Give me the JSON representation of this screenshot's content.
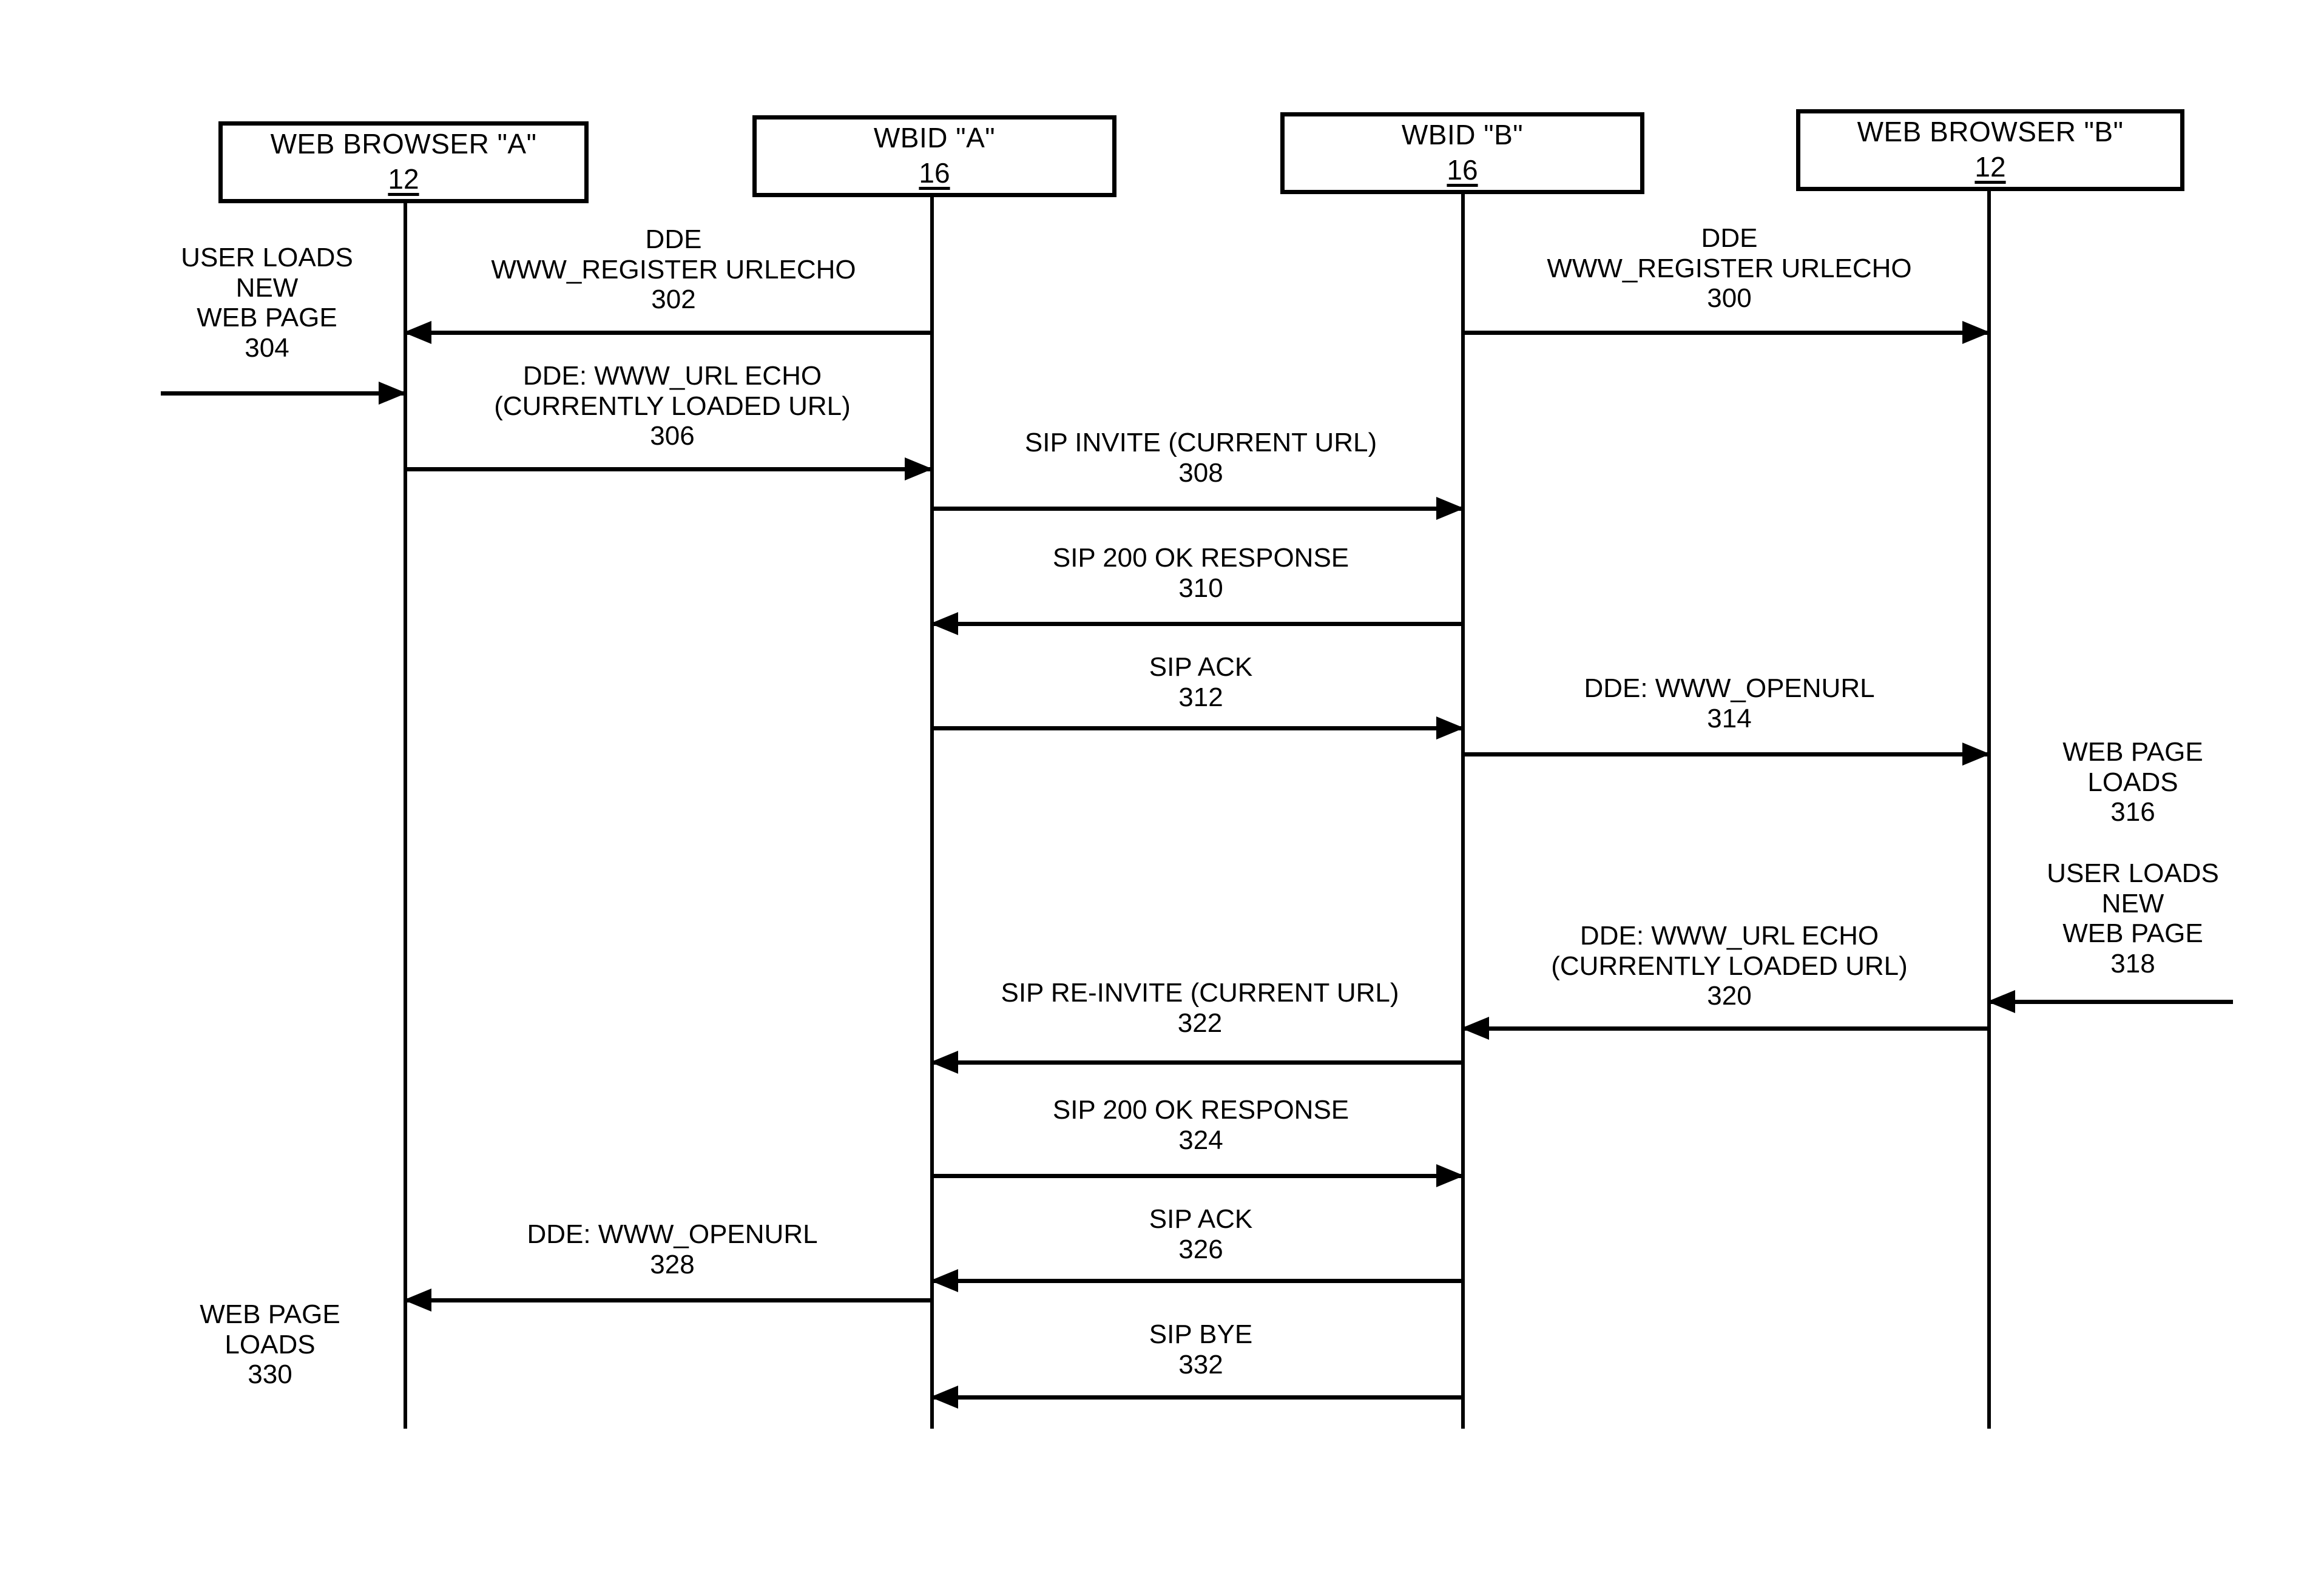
{
  "figure": {
    "type": "sip-web-browser-sequence-diagram"
  },
  "actors": [
    {
      "id": "browser-a",
      "title": "WEB BROWSER \"A\"",
      "number": "12"
    },
    {
      "id": "wbid-a",
      "title": "WBID \"A\"",
      "number": "16"
    },
    {
      "id": "wbid-b",
      "title": "WBID \"B\"",
      "number": "16"
    },
    {
      "id": "browser-b",
      "title": "WEB BROWSER \"B\"",
      "number": "12"
    }
  ],
  "messages": [
    {
      "id": "m302",
      "lines": [
        "DDE",
        "WWW_REGISTER URLECHO"
      ],
      "number": "302",
      "direction": "left",
      "from": "wbid-a",
      "to": "browser-a"
    },
    {
      "id": "m300",
      "lines": [
        "DDE",
        "WWW_REGISTER URLECHO"
      ],
      "number": "300",
      "direction": "right",
      "from": "wbid-b",
      "to": "browser-b"
    },
    {
      "id": "m306",
      "lines": [
        "DDE:  WWW_URL ECHO",
        "(CURRENTLY LOADED URL)"
      ],
      "number": "306",
      "direction": "right",
      "from": "browser-a",
      "to": "wbid-a"
    },
    {
      "id": "m308",
      "lines": [
        "SIP INVITE (CURRENT URL)"
      ],
      "number": "308",
      "direction": "right",
      "from": "wbid-a",
      "to": "wbid-b"
    },
    {
      "id": "m310",
      "lines": [
        "SIP 200 OK RESPONSE"
      ],
      "number": "310",
      "direction": "left",
      "from": "wbid-b",
      "to": "wbid-a"
    },
    {
      "id": "m312",
      "lines": [
        "SIP ACK"
      ],
      "number": "312",
      "direction": "right",
      "from": "wbid-a",
      "to": "wbid-b"
    },
    {
      "id": "m314",
      "lines": [
        "DDE:  WWW_OPENURL"
      ],
      "number": "314",
      "direction": "right",
      "from": "wbid-b",
      "to": "browser-b"
    },
    {
      "id": "m320",
      "lines": [
        "DDE:  WWW_URL ECHO",
        "(CURRENTLY LOADED URL)"
      ],
      "number": "320",
      "direction": "left",
      "from": "browser-b",
      "to": "wbid-b"
    },
    {
      "id": "m322",
      "lines": [
        "SIP RE-INVITE (CURRENT URL)"
      ],
      "number": "322",
      "direction": "left",
      "from": "wbid-b",
      "to": "wbid-a"
    },
    {
      "id": "m324",
      "lines": [
        "SIP 200 OK RESPONSE"
      ],
      "number": "324",
      "direction": "right",
      "from": "wbid-a",
      "to": "wbid-b"
    },
    {
      "id": "m326",
      "lines": [
        "SIP ACK"
      ],
      "number": "326",
      "direction": "left",
      "from": "wbid-b",
      "to": "wbid-a"
    },
    {
      "id": "m328",
      "lines": [
        "DDE:  WWW_OPENURL"
      ],
      "number": "328",
      "direction": "left",
      "from": "wbid-a",
      "to": "browser-a"
    },
    {
      "id": "m332",
      "lines": [
        "SIP BYE"
      ],
      "number": "332",
      "direction": "left",
      "from": "wbid-b",
      "to": "wbid-a"
    }
  ],
  "annotations": [
    {
      "id": "a304",
      "lines": [
        "USER LOADS",
        "NEW",
        "WEB PAGE"
      ],
      "number": "304",
      "side": "left-of-browser-a"
    },
    {
      "id": "a316",
      "lines": [
        "WEB PAGE",
        "LOADS"
      ],
      "number": "316",
      "side": "right-of-browser-b"
    },
    {
      "id": "a318",
      "lines": [
        "USER LOADS",
        "NEW",
        "WEB PAGE"
      ],
      "number": "318",
      "side": "right-of-browser-b"
    },
    {
      "id": "a330",
      "lines": [
        "WEB PAGE",
        "LOADS"
      ],
      "number": "330",
      "side": "left-of-browser-a"
    }
  ]
}
